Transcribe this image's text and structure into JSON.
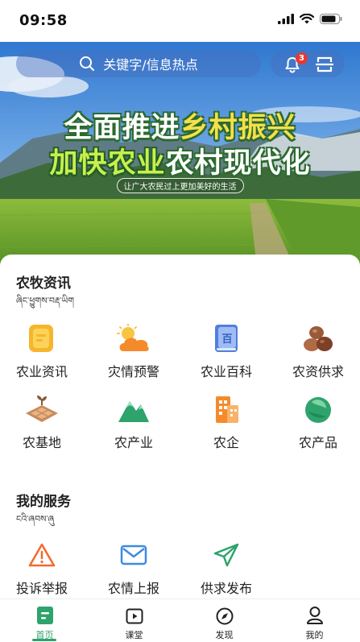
{
  "status_bar": {
    "time": "09:58"
  },
  "search": {
    "placeholder": "关键字/信息热点"
  },
  "notifications": {
    "count": "3"
  },
  "banner": {
    "line1_a": "全面推进",
    "line1_b": "乡村振兴",
    "line2_a": "加快农业",
    "line2_b": "农村现代化",
    "subtitle": "让广大农民过上更加美好的生活"
  },
  "news_section": {
    "title": "农牧资讯",
    "subtitle_tibetan": "ཞིང་ཕྱུགས་བརྡ་ཡིག",
    "items": [
      {
        "label": "农业资讯",
        "icon": "news-icon"
      },
      {
        "label": "灾情预警",
        "icon": "weather-warning-icon"
      },
      {
        "label": "农业百科",
        "icon": "encyclopedia-icon"
      },
      {
        "label": "农资供求",
        "icon": "beans-icon"
      },
      {
        "label": "农基地",
        "icon": "farm-base-icon"
      },
      {
        "label": "农产业",
        "icon": "mountain-icon"
      },
      {
        "label": "农企",
        "icon": "building-icon"
      },
      {
        "label": "农产品",
        "icon": "cabbage-icon"
      }
    ]
  },
  "service_section": {
    "title": "我的服务",
    "subtitle_tibetan": "ངའི་ཞབས་ཞུ",
    "items": [
      {
        "label": "投诉举报",
        "icon": "warning-icon"
      },
      {
        "label": "农情上报",
        "icon": "mail-icon"
      },
      {
        "label": "供求发布",
        "icon": "send-icon"
      }
    ]
  },
  "bottom_nav": {
    "items": [
      {
        "label": "首页",
        "icon": "home-icon"
      },
      {
        "label": "课堂",
        "icon": "video-icon"
      },
      {
        "label": "发现",
        "icon": "compass-icon"
      },
      {
        "label": "我的",
        "icon": "user-icon"
      }
    ],
    "active_index": 0
  },
  "colors": {
    "accent": "#2ea36b",
    "badge": "#e53935"
  }
}
